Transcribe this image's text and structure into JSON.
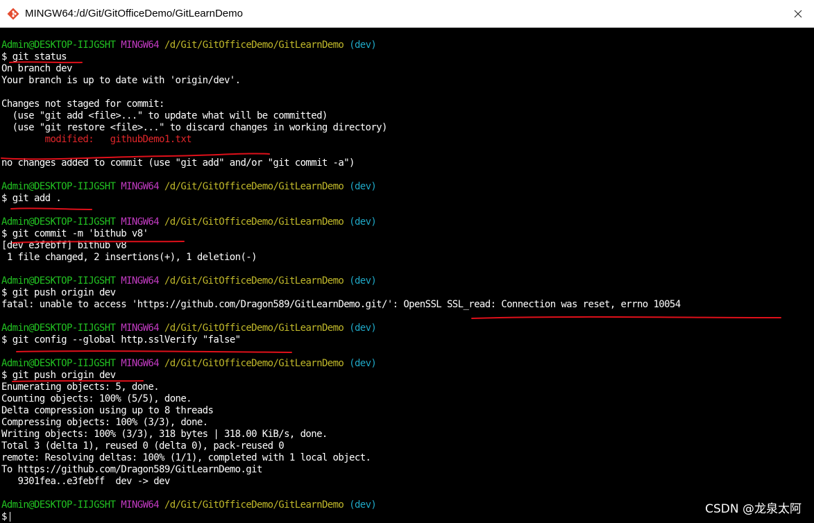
{
  "window": {
    "title": "MINGW64:/d/Git/GitOfficeDemo/GitLearnDemo",
    "icon": "git-diamond-icon",
    "controls": [
      "close-icon"
    ]
  },
  "prompt": {
    "user": "Admin@DESKTOP-IIJGSHT",
    "system": "MINGW64",
    "path": "/d/Git/GitOfficeDemo/GitLearnDemo",
    "branch": "(dev)",
    "symbol": "$"
  },
  "colors": {
    "user": "#22c322",
    "system": "#c23bc2",
    "path": "#c0b82a",
    "branch": "#1fa9c8",
    "modified": "#e0262a",
    "annotation": "#e0101a"
  },
  "session": {
    "cmd1": "git status",
    "out1": [
      "On branch dev",
      "Your branch is up to date with 'origin/dev'.",
      "",
      "Changes not staged for commit:",
      "  (use \"git add <file>...\" to update what will be committed)",
      "  (use \"git restore <file>...\" to discard changes in working directory)"
    ],
    "modified_line": "        modified:   githubDemo1.txt",
    "out1b": "no changes added to commit (use \"git add\" and/or \"git commit -a\")",
    "cmd2": "git add .",
    "cmd3": "git commit -m 'bithub v8'",
    "out3": [
      "[dev e3febff] bithub v8",
      " 1 file changed, 2 insertions(+), 1 deletion(-)"
    ],
    "cmd4": "git push origin dev",
    "out4": "fatal: unable to access 'https://github.com/Dragon589/GitLearnDemo.git/': OpenSSL SSL_read: Connection was reset, errno 10054",
    "cmd5": "git config --global http.sslVerify \"false\"",
    "cmd6": "git push origin dev",
    "out6": [
      "Enumerating objects: 5, done.",
      "Counting objects: 100% (5/5), done.",
      "Delta compression using up to 8 threads",
      "Compressing objects: 100% (3/3), done.",
      "Writing objects: 100% (3/3), 318 bytes | 318.00 KiB/s, done.",
      "Total 3 (delta 1), reused 0 (delta 0), pack-reused 0",
      "remote: Resolving deltas: 100% (1/1), completed with 1 local object.",
      "To https://github.com/Dragon589/GitLearnDemo.git",
      "   9301fea..e3febff  dev -> dev"
    ]
  },
  "watermark": "CSDN @龙泉太阿"
}
